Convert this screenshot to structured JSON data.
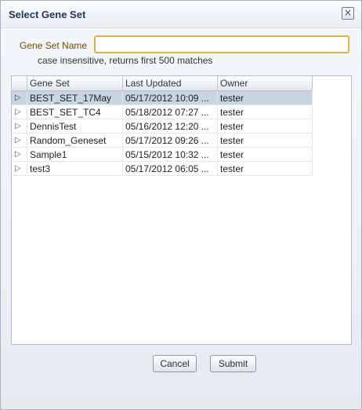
{
  "dialog": {
    "title": "Select Gene Set",
    "close_icon": "close-icon"
  },
  "search": {
    "label": "Gene Set Name",
    "value": "",
    "placeholder": "",
    "hint": "case insensitive, returns first 500 matches"
  },
  "table": {
    "columns": [
      "Gene Set",
      "Last Updated",
      "Owner"
    ],
    "selected_index": 0,
    "rows": [
      {
        "name": "BEST_SET_17May",
        "updated": "05/17/2012 10:09 ...",
        "owner": "tester"
      },
      {
        "name": "BEST_SET_TC4",
        "updated": "05/18/2012 07:27 ...",
        "owner": "tester"
      },
      {
        "name": "DennisTest",
        "updated": "05/16/2012 12:20 ...",
        "owner": "tester"
      },
      {
        "name": "Random_Geneset",
        "updated": "05/17/2012 09:26 ...",
        "owner": "tester"
      },
      {
        "name": "Sample1",
        "updated": "05/15/2012 10:32 ...",
        "owner": "tester"
      },
      {
        "name": "test3",
        "updated": "05/17/2012 06:05 ...",
        "owner": "tester"
      }
    ]
  },
  "buttons": {
    "cancel": "Cancel",
    "submit": "Submit"
  }
}
